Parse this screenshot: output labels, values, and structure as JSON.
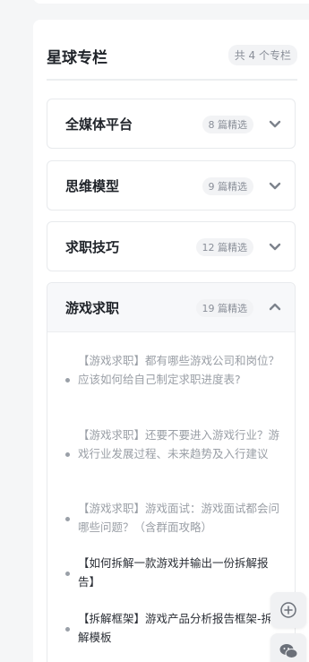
{
  "section": {
    "title": "星球专栏",
    "count_label": "共 4 个专栏"
  },
  "categories": [
    {
      "name": "全媒体平台",
      "badge": "8 篇精选"
    },
    {
      "name": "思维模型",
      "badge": "9 篇精选"
    },
    {
      "name": "求职技巧",
      "badge": "12 篇精选"
    },
    {
      "name": "游戏求职",
      "badge": "19 篇精选"
    }
  ],
  "articles": [
    {
      "text": "【游戏求职】都有哪些游戏公司和岗位？应该如何给自己制定求职进度表?"
    },
    {
      "text": "【游戏求职】还要不要进入游戏行业？游戏行业发展过程、未来趋势及入行建议"
    },
    {
      "text": "【游戏求职】游戏面试：游戏面试都会问哪些问题？（含群面攻略）"
    },
    {
      "text": "【如何拆解一款游戏并输出一份拆解报告】"
    },
    {
      "text": "【拆解框架】游戏产品分析报告框架-拆解模板"
    }
  ],
  "floating": {
    "add_icon": "plus-circle-icon",
    "wechat_icon": "wechat-icon"
  }
}
